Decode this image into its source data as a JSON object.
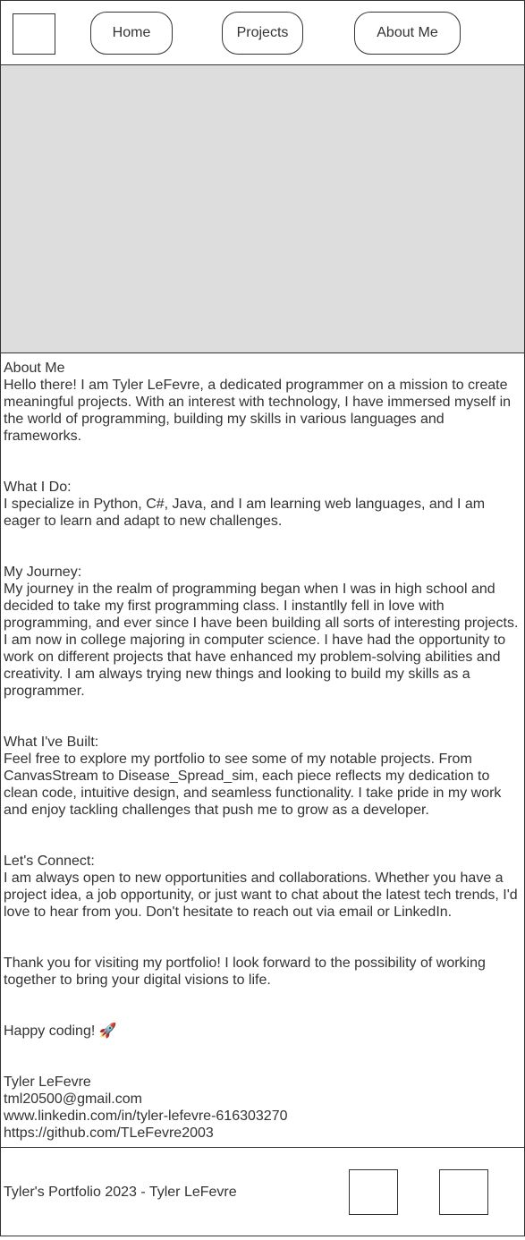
{
  "nav": {
    "home_label": "Home",
    "projects_label": "Projects",
    "about_label": "About Me"
  },
  "about": {
    "heading": "About Me",
    "intro": "Hello there! I am Tyler LeFevre, a dedicated programmer on a mission to create meaningful projects. With an interest with technology, I have immersed myself in the world of programming, building my skills in various languages and frameworks.",
    "what_i_do_heading": "What I Do:",
    "what_i_do_text": "I specialize in Python, C#, Java, and I am learning web languages, and I am eager to learn and adapt to new challenges.",
    "journey_heading": "My Journey:",
    "journey_text": "My journey in the realm of programming began when I was in high school and decided to take my first programming class. I instantlly fell in love with programming, and ever since I have been building all sorts of interesting projects. I am now in college majoring in computer science. I have had the opportunity to work on different projects that have enhanced my problem-solving abilities and creativity. I am always trying new things and looking to build my skills as a programmer.",
    "built_heading": "What I've Built:",
    "built_text": "Feel free to explore my portfolio to see some of my notable projects. From CanvasStream to Disease_Spread_sim, each piece reflects my dedication to clean code, intuitive design, and seamless functionality. I take pride in my work and enjoy tackling challenges that push me to grow as a developer.",
    "connect_heading": "Let's Connect:",
    "connect_text": "I am always open to new opportunities and collaborations. Whether you have a project idea, a job opportunity, or just want to chat about the latest tech trends, I'd love to hear from you. Don't hesitate to reach out via email or LinkedIn.",
    "thanks_text": "Thank you for visiting my portfolio! I look forward to the possibility of working together to bring your digital visions to life.",
    "happy_coding": "Happy coding! 🚀"
  },
  "contact": {
    "name": "Tyler LeFevre",
    "email": "tml20500@gmail.com",
    "linkedin": "www.linkedin.com/in/tyler-lefevre-616303270",
    "github": "https://github.com/TLeFevre2003"
  },
  "footer": {
    "copyright": "Tyler's Portfolio 2023 - Tyler LeFevre"
  },
  "icons": {
    "happy_coding_icon": "rocket-icon"
  }
}
